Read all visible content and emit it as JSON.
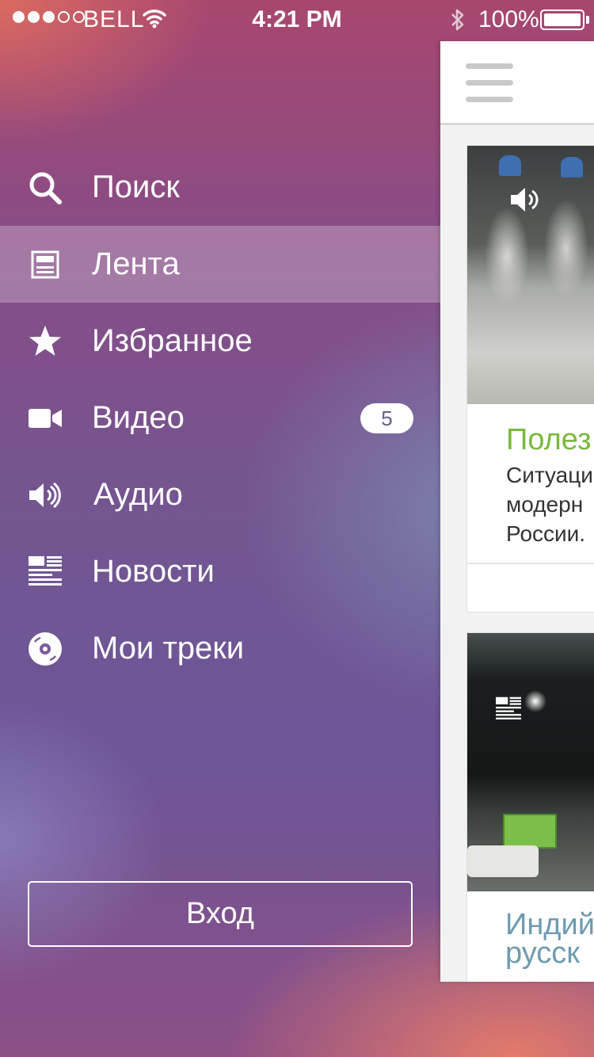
{
  "status_bar": {
    "signal_dots_filled": 3,
    "signal_dots_total": 5,
    "carrier": "BELL",
    "time": "4:21 PM",
    "battery": "100%"
  },
  "menu": {
    "items": [
      {
        "id": "search",
        "label": "Поиск",
        "icon": "search-icon"
      },
      {
        "id": "feed",
        "label": "Лента",
        "icon": "feed-icon",
        "active": true
      },
      {
        "id": "favorites",
        "label": "Избранное",
        "icon": "star-icon"
      },
      {
        "id": "video",
        "label": "Видео",
        "icon": "video-camera-icon",
        "badge": "5"
      },
      {
        "id": "audio",
        "label": "Аудио",
        "icon": "speaker-icon"
      },
      {
        "id": "news",
        "label": "Новости",
        "icon": "news-icon"
      },
      {
        "id": "tracks",
        "label": "Мои треки",
        "icon": "disc-icon"
      }
    ],
    "login_label": "Вход"
  },
  "feed": {
    "cards": [
      {
        "type": "audio",
        "title": "Полез",
        "excerpt": [
          "Ситуаци",
          "модерн",
          "России."
        ]
      },
      {
        "type": "news",
        "title": [
          "Индий",
          "русск"
        ]
      }
    ]
  },
  "colors": {
    "title_green": "#79b93c",
    "title_blue": "#6e9bb1"
  }
}
